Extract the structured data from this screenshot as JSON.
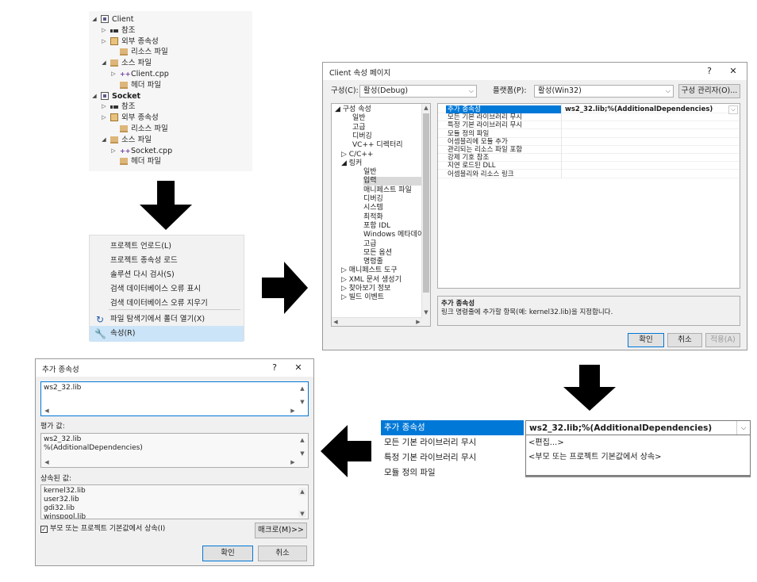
{
  "solution_tree": {
    "items": [
      {
        "label": "Client",
        "bold": false,
        "expander": "◢",
        "icon": "project-icon"
      },
      {
        "label": "참조",
        "expander": "▷",
        "icon": "references-icon"
      },
      {
        "label": "외부 종속성",
        "expander": "▷",
        "icon": "external-dependencies-icon"
      },
      {
        "label": "리소스 파일",
        "expander": "",
        "icon": "filter-folder-icon"
      },
      {
        "label": "소스 파일",
        "expander": "◢",
        "icon": "filter-folder-icon"
      },
      {
        "label": "Client.cpp",
        "expander": "▷",
        "icon": "cpp-file-icon"
      },
      {
        "label": "헤더 파일",
        "expander": "",
        "icon": "filter-folder-icon"
      },
      {
        "label": "Socket",
        "bold": true,
        "expander": "◢",
        "icon": "project-icon"
      },
      {
        "label": "참조",
        "expander": "▷",
        "icon": "references-icon"
      },
      {
        "label": "외부 종속성",
        "expander": "▷",
        "icon": "external-dependencies-icon"
      },
      {
        "label": "리소스 파일",
        "expander": "",
        "icon": "filter-folder-icon"
      },
      {
        "label": "소스 파일",
        "expander": "◢",
        "icon": "filter-folder-icon"
      },
      {
        "label": "Socket.cpp",
        "expander": "▷",
        "icon": "cpp-file-icon"
      },
      {
        "label": "헤더 파일",
        "expander": "",
        "icon": "filter-folder-icon"
      }
    ]
  },
  "context_menu": {
    "items": [
      {
        "label": "프로젝트 언로드(L)",
        "icon": ""
      },
      {
        "label": "프로젝트 종속성 로드",
        "icon": ""
      },
      {
        "label": "솔루션 다시 검사(S)",
        "icon": ""
      },
      {
        "label": "검색 데이터베이스 오류 표시",
        "icon": ""
      },
      {
        "label": "검색 데이터베이스 오류 지우기",
        "icon": ""
      },
      {
        "label": "파일 탐색기에서 폴더 열기(X)",
        "icon": "open-folder-icon"
      },
      {
        "label": "속성(R)",
        "icon": "wrench-icon",
        "selected": true
      }
    ]
  },
  "property_pages": {
    "title": "Client 속성 페이지",
    "help": "?",
    "close": "✕",
    "config_label": "구성(C):",
    "config_value": "활성(Debug)",
    "platform_label": "플랫폼(P):",
    "platform_value": "활성(Win32)",
    "config_manager": "구성 관리자(O)...",
    "tree": [
      {
        "label": "◢ 구성 속성",
        "indent": 0
      },
      {
        "label": "일반",
        "indent": 2
      },
      {
        "label": "고급",
        "indent": 2
      },
      {
        "label": "디버깅",
        "indent": 2
      },
      {
        "label": "VC++ 디렉터리",
        "indent": 2
      },
      {
        "label": "▷ C/C++",
        "indent": 1
      },
      {
        "label": "◢ 링커",
        "indent": 1
      },
      {
        "label": "일반",
        "indent": 3
      },
      {
        "label": "입력",
        "indent": 3,
        "selected": true
      },
      {
        "label": "매니페스트 파일",
        "indent": 3
      },
      {
        "label": "디버깅",
        "indent": 3
      },
      {
        "label": "시스템",
        "indent": 3
      },
      {
        "label": "최적화",
        "indent": 3
      },
      {
        "label": "포함 IDL",
        "indent": 3
      },
      {
        "label": "Windows 메타데이",
        "indent": 3
      },
      {
        "label": "고급",
        "indent": 3
      },
      {
        "label": "모든 옵션",
        "indent": 3
      },
      {
        "label": "명령줄",
        "indent": 3
      },
      {
        "label": "▷ 매니페스트 도구",
        "indent": 1
      },
      {
        "label": "▷ XML 문서 생성기",
        "indent": 1
      },
      {
        "label": "▷ 찾아보기 정보",
        "indent": 1
      },
      {
        "label": "▷ 빌드 이벤트",
        "indent": 1
      }
    ],
    "grid": [
      {
        "key": "추가 종속성",
        "value": "ws2_32.lib;%(AdditionalDependencies)",
        "selected": true
      },
      {
        "key": "모든 기본 라이브러리 무시",
        "value": ""
      },
      {
        "key": "특정 기본 라이브러리 무시",
        "value": ""
      },
      {
        "key": "모듈 정의 파일",
        "value": ""
      },
      {
        "key": "어셈블리에 모듈 추가",
        "value": ""
      },
      {
        "key": "관리되는 리소스 파일 포함",
        "value": ""
      },
      {
        "key": "강제 기호 참조",
        "value": ""
      },
      {
        "key": "지연 로드된 DLL",
        "value": ""
      },
      {
        "key": "어셈블리와 리소스 링크",
        "value": ""
      }
    ],
    "desc_title": "추가 종속성",
    "desc_text": "링크 명령줄에 추가할 항목(예: kernel32.lib)을 지정합니다.",
    "ok": "확인",
    "cancel": "취소",
    "apply": "적용(A)"
  },
  "dropdown_crop": {
    "rows": [
      {
        "key": "추가 종속성",
        "value": "ws2_32.lib;%(AdditionalDependencies)"
      },
      {
        "key": "모든 기본 라이브러리 무시",
        "value": ""
      },
      {
        "key": "특정 기본 라이브러리 무시",
        "value": ""
      },
      {
        "key": "모듈 정의 파일",
        "value": ""
      }
    ],
    "options": [
      "<편집...>",
      "<부모 또는 프로젝트 기본값에서 상속>"
    ]
  },
  "additional_deps": {
    "title": "추가 종속성",
    "help": "?",
    "close": "✕",
    "edit_value": "ws2_32.lib",
    "evaluated_label": "평가 값:",
    "evaluated_lines": [
      "ws2_32.lib",
      "%(AdditionalDependencies)"
    ],
    "inherited_label": "상속된 값:",
    "inherited_lines": [
      "kernel32.lib",
      "user32.lib",
      "gdi32.lib",
      "winspool.lib"
    ],
    "inherit_checkbox": "부모 또는 프로젝트 기본값에서 상속(I)",
    "macro_button": "매크로(M)>>",
    "ok": "확인",
    "cancel": "취소"
  },
  "colors": {
    "accent": "#0078d7",
    "selection": "#cce4f7",
    "arrow": "#000000"
  }
}
